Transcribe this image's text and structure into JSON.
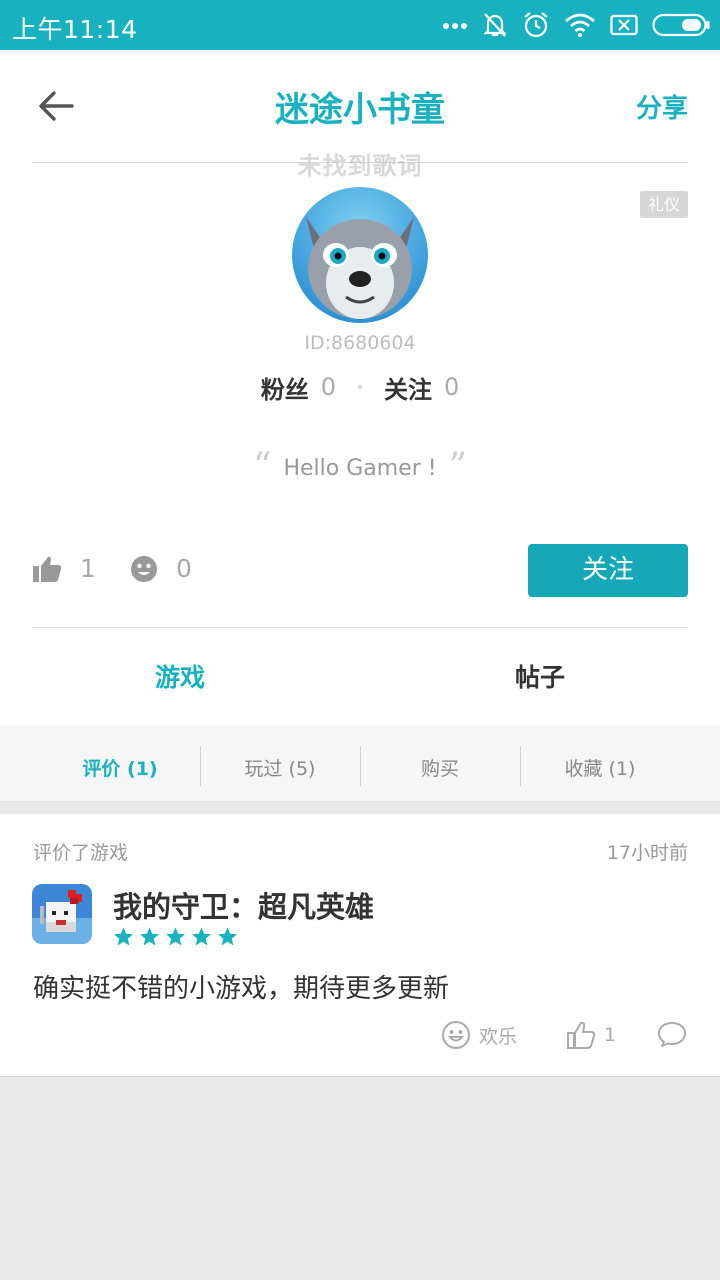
{
  "status_bar": {
    "time": "上午11:14"
  },
  "header": {
    "title": "迷途小书童",
    "share_label": "分享"
  },
  "overlay_text": "未找到歌词",
  "badge": "礼仪",
  "profile": {
    "user_id": "ID:8680604",
    "fans_label": "粉丝",
    "fans_count": "0",
    "following_label": "关注",
    "following_count": "0",
    "bio": "Hello Gamer !",
    "likes_count": "1",
    "smiles_count": "0",
    "follow_button": "关注"
  },
  "tabs": [
    {
      "label": "游戏",
      "active": true
    },
    {
      "label": "帖子",
      "active": false
    }
  ],
  "subtabs": [
    {
      "label": "评价 (1)",
      "active": true
    },
    {
      "label": "玩过 (5)",
      "active": false
    },
    {
      "label": "购买",
      "active": false
    },
    {
      "label": "收藏 (1)",
      "active": false
    }
  ],
  "review": {
    "action": "评价了游戏",
    "time_ago": "17小时前",
    "game_name": "我的守卫：超凡英雄",
    "rating": 5,
    "rating_max": 5,
    "text": "确实挺不错的小游戏，期待更多更新",
    "mood_label": "欢乐",
    "like_count": "1"
  },
  "colors": {
    "accent": "#17b1c0",
    "button": "#17a8b7"
  }
}
